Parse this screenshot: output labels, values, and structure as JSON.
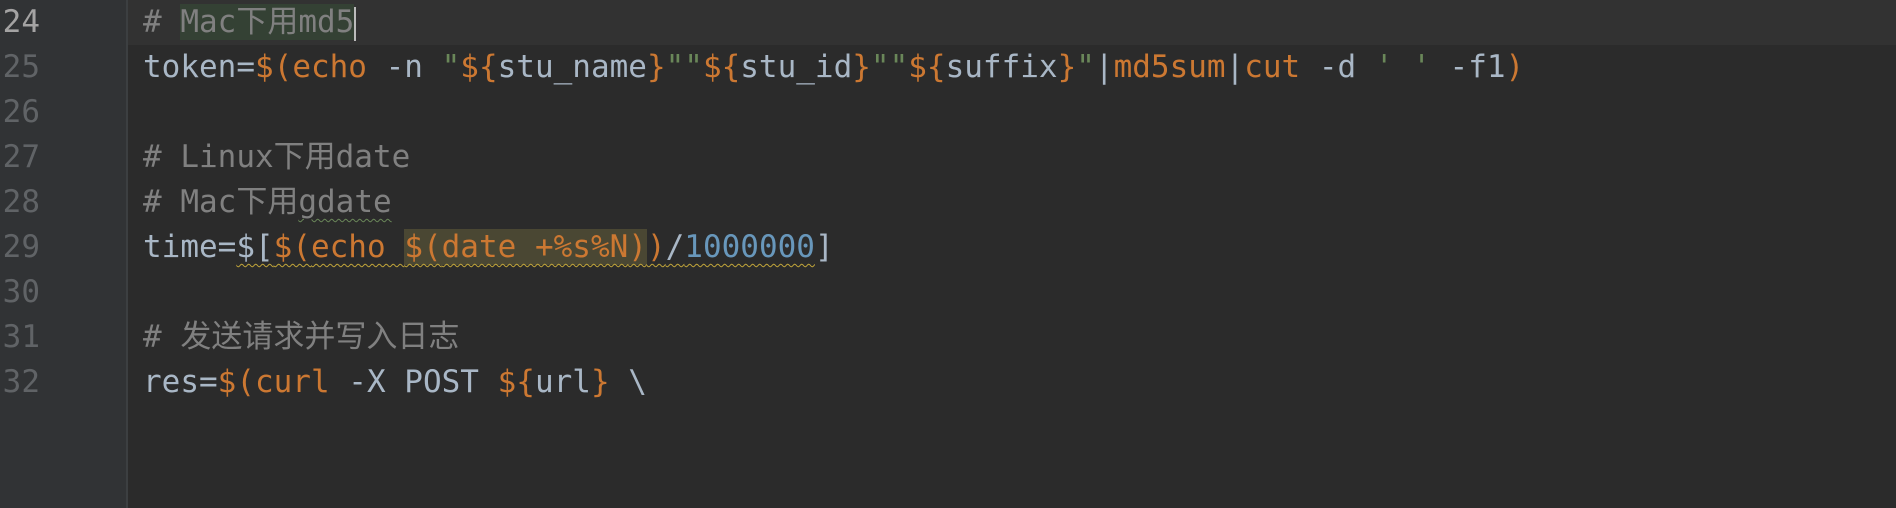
{
  "editor": {
    "lines": [
      {
        "number": "24",
        "segments": [
          "# ",
          "Mac下用md5"
        ]
      },
      {
        "number": "25",
        "segments": [
          "token=",
          "$(",
          "echo",
          " -n ",
          "\"",
          "${",
          "stu_name",
          "}",
          "\"\"",
          "${",
          "stu_id",
          "}",
          "\"\"",
          "${",
          "suffix",
          "}",
          "\"",
          "|",
          "md5sum",
          "|",
          "cut",
          " -d ",
          "' '",
          " -f1",
          ")"
        ]
      },
      {
        "number": "26",
        "segments": []
      },
      {
        "number": "27",
        "segments": [
          "# Linux下用date"
        ]
      },
      {
        "number": "28",
        "segments": [
          "# Mac下用",
          "gdate"
        ]
      },
      {
        "number": "29",
        "segments": [
          "time=",
          "$[",
          "$(",
          "echo ",
          "$(",
          "date +%s%N",
          ")",
          ")",
          "/",
          "1000000",
          "]"
        ]
      },
      {
        "number": "30",
        "segments": []
      },
      {
        "number": "31",
        "segments": [
          "# 发送请求并写入日志"
        ]
      },
      {
        "number": "32",
        "segments": [
          "res=",
          "$(",
          "curl",
          " -X POST ",
          "${",
          "url",
          "}",
          " \\"
        ]
      }
    ]
  },
  "colors": {
    "background": "#2b2b2b",
    "gutter": "#313335",
    "comment": "#808080",
    "keyword": "#cc7832",
    "string": "#6a8759",
    "number": "#6897bb",
    "text": "#a9b7c6"
  }
}
